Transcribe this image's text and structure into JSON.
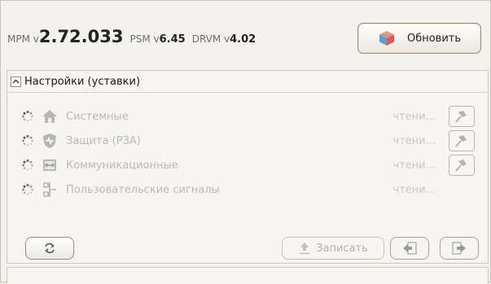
{
  "versions": {
    "mpm_label": "MPM v",
    "mpm_value": "2.72.033",
    "psm_label": "PSM v",
    "psm_value": "6.45",
    "drvm_label": "DRVM v",
    "drvm_value": "4.02"
  },
  "update_button": {
    "label": "Обновить",
    "icon": "cube-icon"
  },
  "settings_panel": {
    "title": "Настройки (уставки)",
    "rows": [
      {
        "label": "Системные",
        "status": "чтени...",
        "icon": "home-icon",
        "has_pin": true
      },
      {
        "label": "Защита (РЗА)",
        "status": "чтени...",
        "icon": "shield-icon",
        "has_pin": true
      },
      {
        "label": "Коммуникационные",
        "status": "чтени...",
        "icon": "exchange-icon",
        "has_pin": true
      },
      {
        "label": "Пользовательские сигналы",
        "status": "чтени...",
        "icon": "signals-icon",
        "has_pin": false
      }
    ],
    "write_button": "Записать",
    "refresh_icon": "refresh-icon",
    "import_icon": "import-icon",
    "export_icon": "export-icon"
  }
}
